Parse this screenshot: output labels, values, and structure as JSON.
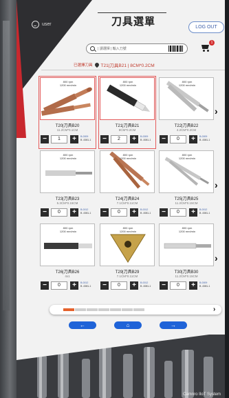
{
  "header": {
    "user_label": "user",
    "title": "刀具選單",
    "logout_label": "LOG OUT"
  },
  "search": {
    "placeholder": "| 請選擇 | 輸入刀號"
  },
  "cart": {
    "badge": "1"
  },
  "selected": {
    "label": "已選擇刀具",
    "value": "T21|刀具B21 | 8CM*0.2CM"
  },
  "cards": [
    {
      "spec1": "800 rpm",
      "spec2": "1200 mm/min",
      "name": "T20|刀具B20",
      "size": "11.2CM*0.1CM",
      "qty": "1",
      "stock1": "B-0009",
      "stock2": "B -0081-1",
      "selected": true
    },
    {
      "spec1": "800 rpm",
      "spec2": "1200 mm/min",
      "name": "T21|刀具B21",
      "size": "8CM*0.2CM",
      "qty": "2",
      "stock1": "B-0009",
      "stock2": "B -0081-1",
      "selected": true
    },
    {
      "spec1": "800 rpm",
      "spec2": "1200 mm/min",
      "name": "T22|刀具B22",
      "size": "4.2CM*0.2CM",
      "qty": "0",
      "stock1": "B-0009",
      "stock2": "B -0081-1",
      "selected": false
    },
    {
      "spec1": "800 rpm",
      "spec2": "1200 mm/min",
      "name": "T23|刀具B23",
      "size": "5.3CM*0.15CM",
      "qty": "0",
      "stock1": "B-0012",
      "stock2": "B -0081-1",
      "selected": false
    },
    {
      "spec1": "800 rpm",
      "spec2": "1200 mm/min",
      "name": "T24|刀具B24",
      "size": "7.1CM*0.11CM",
      "qty": "0",
      "stock1": "B-0012",
      "stock2": "B -0081-1",
      "selected": false
    },
    {
      "spec1": "800 rpm",
      "spec2": "1200 mm/min",
      "name": "T25|刀具B25",
      "size": "11.2CM*0.15CM",
      "qty": "0",
      "stock1": "B-0012",
      "stock2": "B -0081-1",
      "selected": false
    },
    {
      "spec1": "800 rpm",
      "spec2": "1200 mm/min",
      "name": "T26|刀具B26",
      "size": "4x1",
      "qty": "0",
      "stock1": "B-0012",
      "stock2": "B -0081-1",
      "selected": false
    },
    {
      "spec1": "800 rpm",
      "spec2": "1200 mm/min",
      "name": "T29|刀具B29",
      "size": "7.1CM*0.11CM",
      "qty": "0",
      "stock1": "B-0012",
      "stock2": "B -0081-1",
      "selected": false
    },
    {
      "spec1": "800 rpm",
      "spec2": "1200 mm/min",
      "name": "T30|刀具B30",
      "size": "11.2CM*0.15CM",
      "qty": "0",
      "stock1": "B-0009",
      "stock2": "B -0081-1",
      "selected": false
    }
  ],
  "pagination": {
    "pages": 7,
    "active_page": 1,
    "next": "›"
  },
  "nav": {
    "back": "←",
    "home": "⌂",
    "forward": "→"
  },
  "footer": {
    "brand": "Camnro IIoT System"
  },
  "colors": {
    "accent_red": "#c8282e",
    "selected_border": "#e45a5a",
    "nav_blue": "#1f63d8",
    "page_active": "#e5622c"
  }
}
